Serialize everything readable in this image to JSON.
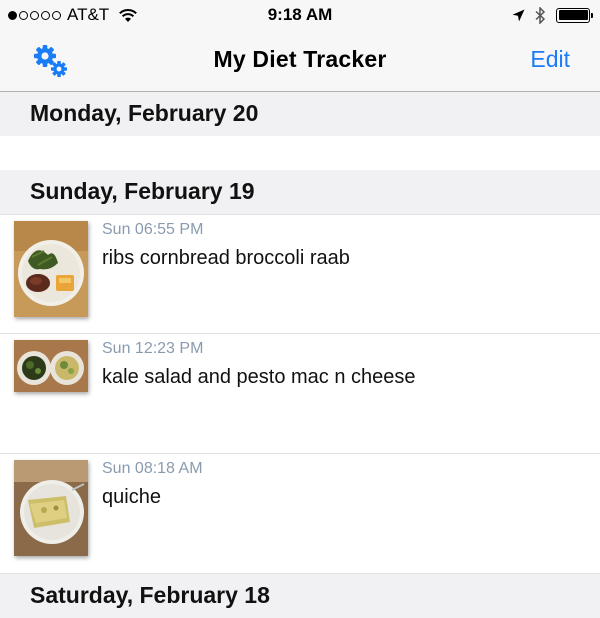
{
  "status_bar": {
    "carrier": "AT&T",
    "time": "9:18 AM"
  },
  "nav": {
    "title": "My Diet Tracker",
    "edit_label": "Edit",
    "accent_color": "#1a7cf6"
  },
  "sections": [
    {
      "header": "Monday, February 20",
      "entries": []
    },
    {
      "header": "Sunday, February 19",
      "entries": [
        {
          "time": "Sun 06:55 PM",
          "text": "ribs cornbread broccoli raab",
          "icon": "meal-photo"
        },
        {
          "time": "Sun 12:23 PM",
          "text": "kale salad and pesto mac n cheese",
          "icon": "meal-photo"
        },
        {
          "time": "Sun 08:18 AM",
          "text": "quiche",
          "icon": "meal-photo"
        }
      ]
    },
    {
      "header": "Saturday, February 18",
      "entries": []
    }
  ]
}
